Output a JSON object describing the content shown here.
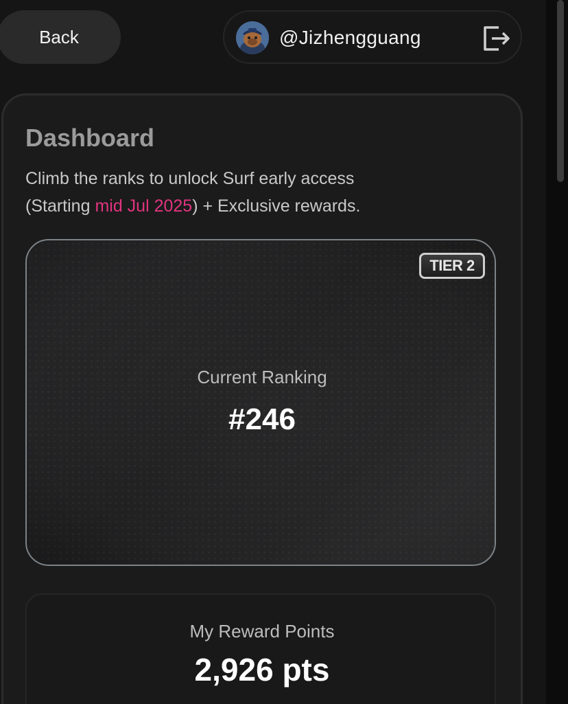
{
  "header": {
    "back_label": "Back",
    "username": "@Jizhengguang"
  },
  "dashboard": {
    "title": "Dashboard",
    "subtitle_line1": "Climb the ranks to unlock Surf early access",
    "subtitle_prefix": "(Starting ",
    "subtitle_highlight": "mid Jul 2025",
    "subtitle_suffix": ") + Exclusive rewards."
  },
  "ranking": {
    "tier": "TIER 2",
    "label": "Current Ranking",
    "value": "#246"
  },
  "rewards": {
    "label": "My Reward Points",
    "value": "2,926 pts"
  },
  "colors": {
    "background": "#151515",
    "accent": "#e0347f",
    "title_gray": "#9b9b9b"
  },
  "icons": [
    "avatar-image",
    "logout-icon"
  ]
}
